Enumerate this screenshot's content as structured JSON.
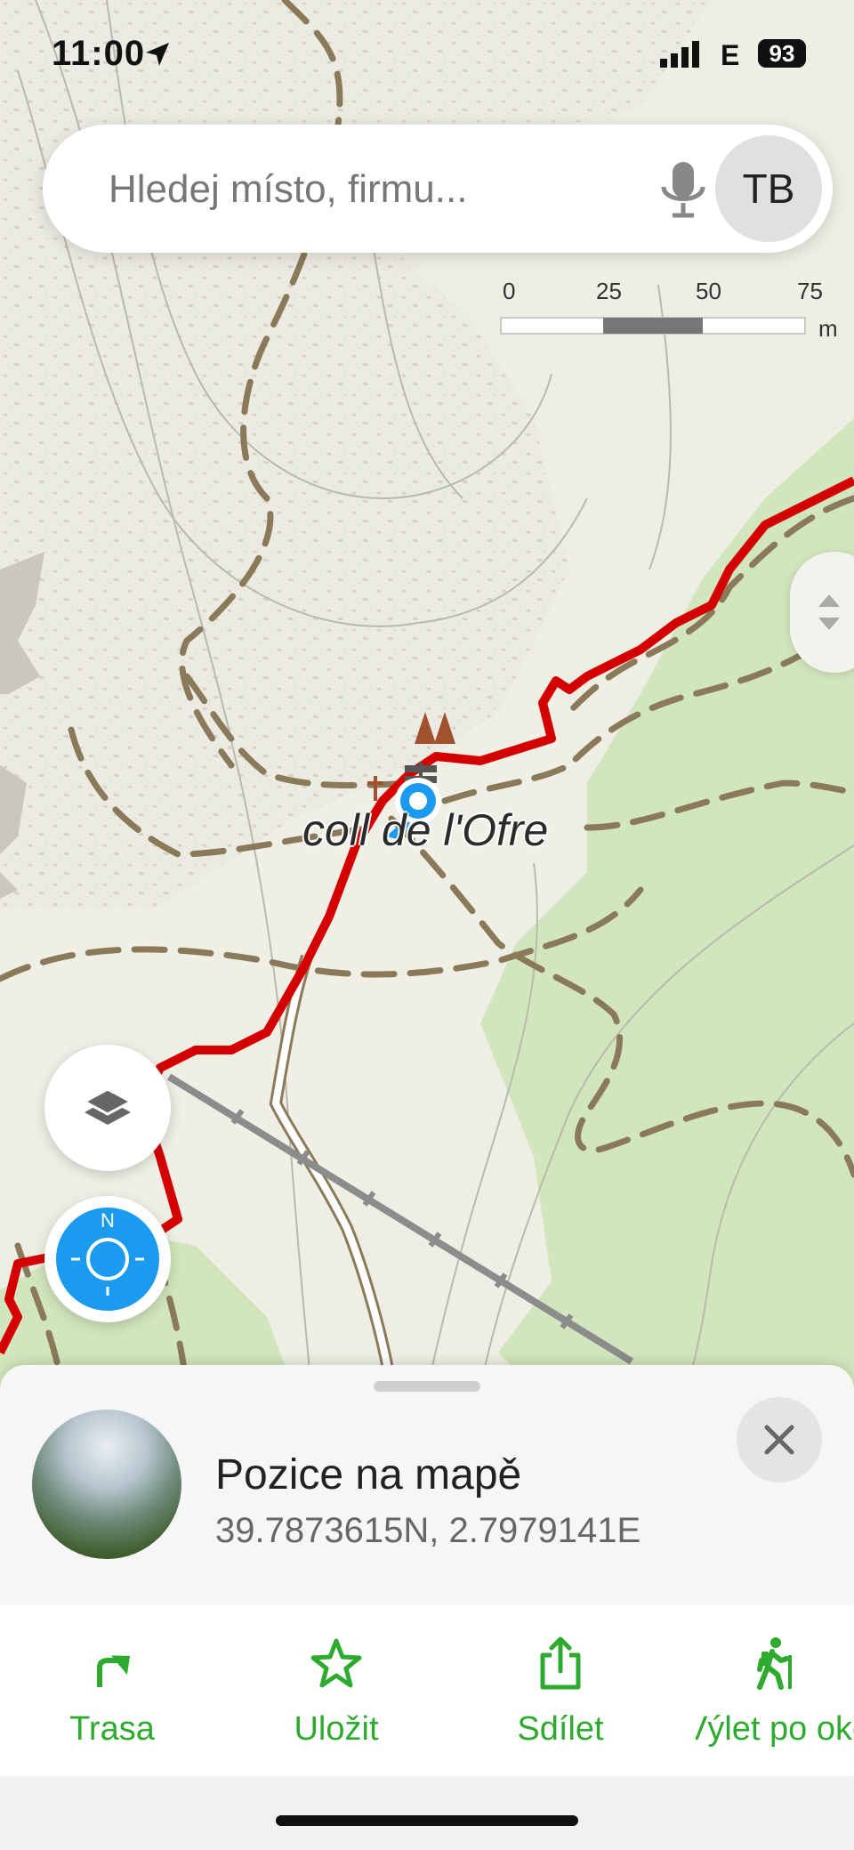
{
  "status_bar": {
    "time": "11:00",
    "network": "E",
    "battery": "93"
  },
  "search": {
    "placeholder": "Hledej místo, firmu...",
    "avatar_initials": "TB"
  },
  "scale": {
    "labels": [
      "0",
      "25",
      "50",
      "75"
    ],
    "unit": "m"
  },
  "map": {
    "place_label": "coll de l'Ofre",
    "compass_letter": "N"
  },
  "sheet": {
    "title": "Pozice na mapě",
    "coordinates": "39.7873615N, 2.7979141E"
  },
  "actions": [
    {
      "label": "Trasa",
      "icon": "route-arrow-icon"
    },
    {
      "label": "Uložit",
      "icon": "star-icon"
    },
    {
      "label": "Sdílet",
      "icon": "share-icon"
    },
    {
      "label": "Výlet po oko",
      "icon": "hiker-icon"
    }
  ],
  "colors": {
    "accent_green": "#2eab2e",
    "route_red": "#d40000",
    "location_blue": "#1a9bf0"
  }
}
